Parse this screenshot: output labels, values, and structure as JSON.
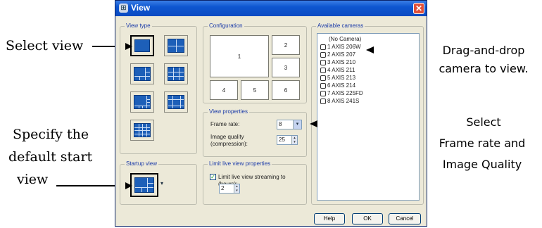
{
  "dialog": {
    "title": "View",
    "close_glyph": "✕"
  },
  "callouts": {
    "select_view": "Select view",
    "start_view": [
      "Specify the",
      "default start",
      "view"
    ],
    "drag_drop": [
      "Drag-and-drop",
      "camera to view."
    ],
    "select_frame": [
      "Select",
      "Frame rate and",
      "Image Quality"
    ]
  },
  "groups": {
    "view_type": "View type",
    "configuration": "Configuration",
    "available_cameras": "Available cameras",
    "view_properties": "View properties",
    "startup_view": "Startup view",
    "limit_live": "Limit live view properties"
  },
  "configuration_cells": [
    "1",
    "2",
    "3",
    "4",
    "5",
    "6"
  ],
  "cameras": [
    "(No Camera)",
    "1  AXIS 206W",
    "2  AXIS 207",
    "3  AXIS 210",
    "4  AXIS 211",
    "5  AXIS 213",
    "6  AXIS 214",
    "7  AXIS 225FD",
    "8  AXIS 241S"
  ],
  "view_properties": {
    "frame_rate_label": "Frame rate:",
    "frame_rate_value": "8",
    "image_quality_label": "Image quality",
    "image_quality_sub": "(compression):",
    "image_quality_value": "25"
  },
  "limit_live": {
    "checkbox_label": "Limit live view streaming to (hours):",
    "checked": true,
    "hours_value": "2"
  },
  "buttons": {
    "help": "Help",
    "ok": "OK",
    "cancel": "Cancel"
  },
  "colors": {
    "titlebar": "#0e56d0",
    "dialog_bg": "#ece9d8",
    "view_tile": "#1d5fb8"
  }
}
